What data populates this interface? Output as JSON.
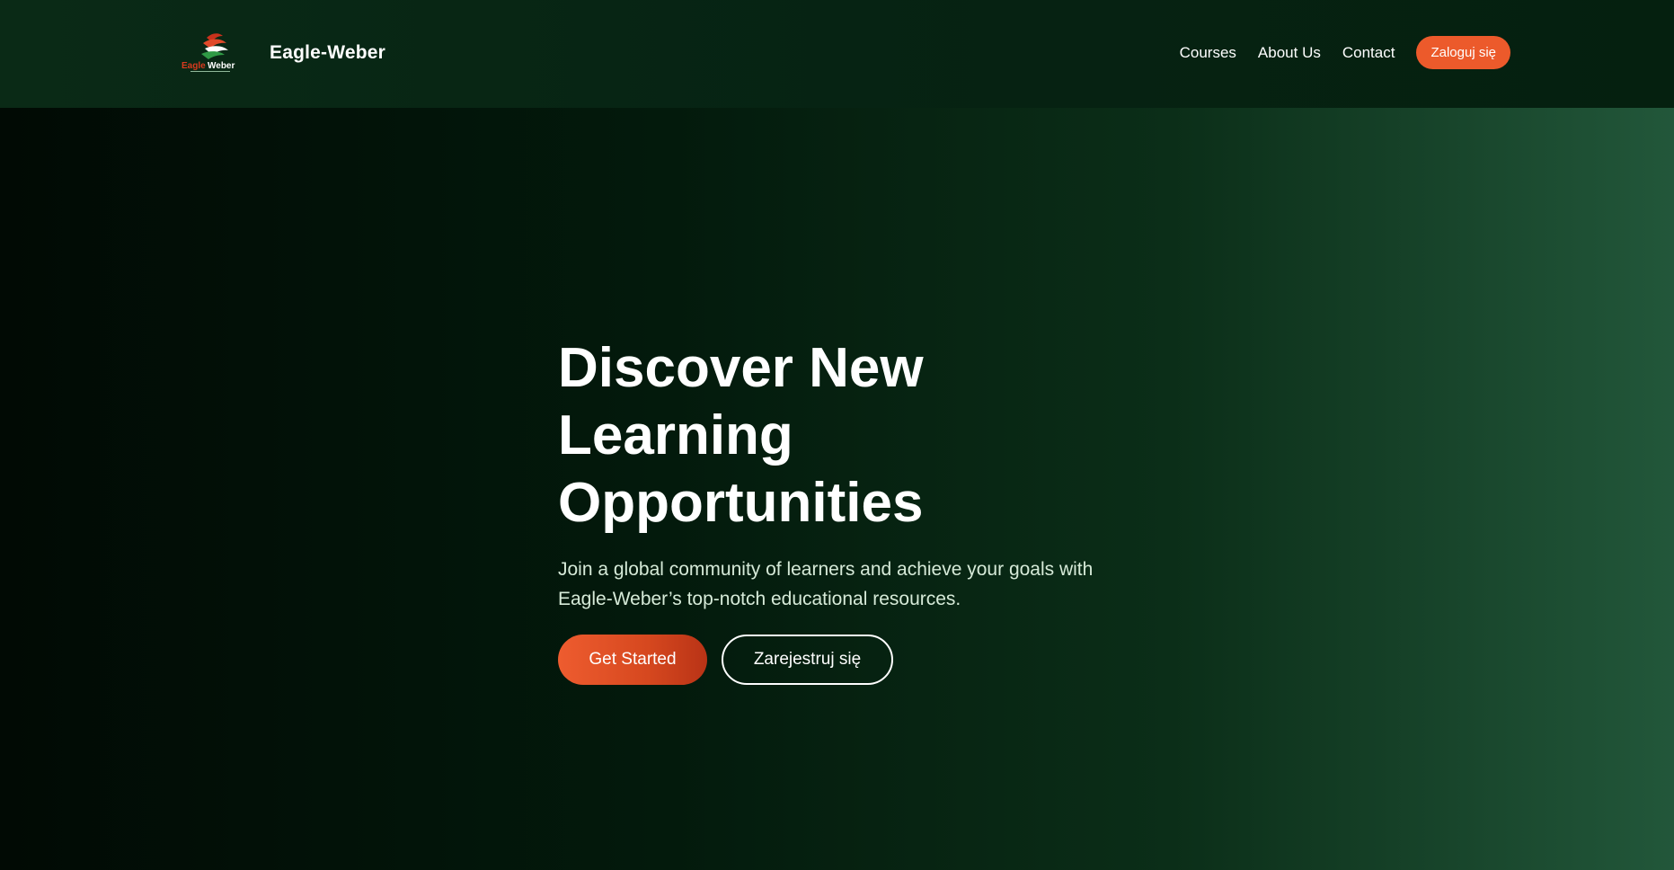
{
  "header": {
    "logo_icon": "eagle-weber-logo",
    "logo_text": "Eagle Weber",
    "brand_name": "Eagle-Weber",
    "nav": [
      {
        "label": "Courses"
      },
      {
        "label": "About Us"
      },
      {
        "label": "Contact"
      }
    ],
    "login_label": "Zaloguj się"
  },
  "hero": {
    "title": "Discover New\nLearning\nOpportunities",
    "subtitle": "Join a global community of learners and achieve your goals with Eagle-Weber’s top-notch educational resources.",
    "primary_cta": "Get Started",
    "secondary_cta": "Zarejestruj się"
  },
  "colors": {
    "accent": "#ec5a2b",
    "background_dark": "#010a04",
    "background_green": "#22573a",
    "text": "#ffffff"
  }
}
